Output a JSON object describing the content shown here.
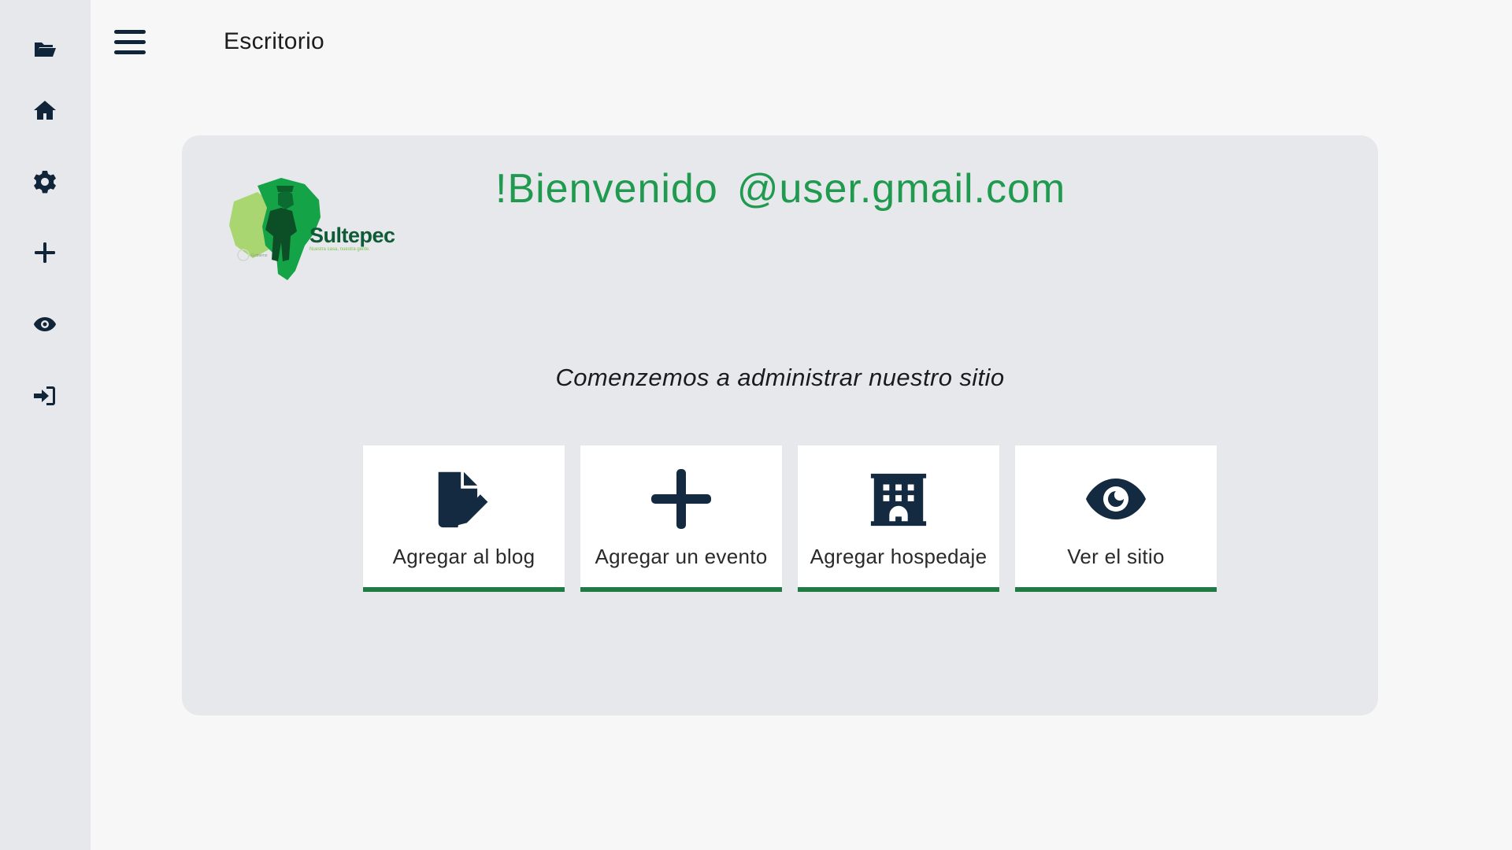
{
  "sidebar": {
    "items": [
      {
        "icon": "folder-open-icon"
      },
      {
        "icon": "home-icon"
      },
      {
        "icon": "gear-icon"
      },
      {
        "icon": "plus-icon"
      },
      {
        "icon": "eye-icon"
      },
      {
        "icon": "sign-in-icon"
      }
    ]
  },
  "header": {
    "menu_icon": "hamburger-icon",
    "title": "Escritorio"
  },
  "card": {
    "logo_text": "Sultepec",
    "logo_tagline": "Nuestra casa, nuestra gente.",
    "welcome_prefix": "!Bienvenido",
    "welcome_user": "@user.gmail.com",
    "subtitle": "Comenzemos a administrar nuestro sitio",
    "actions": [
      {
        "label": "Agregar al blog",
        "icon": "file-edit-icon"
      },
      {
        "label": "Agregar un evento",
        "icon": "plus-icon"
      },
      {
        "label": "Agregar hospedaje",
        "icon": "hotel-building-icon"
      },
      {
        "label": "Ver el sitio",
        "icon": "eye-icon"
      }
    ]
  },
  "colors": {
    "accent_green": "#1f9a4f",
    "tile_border": "#1f7a44",
    "icon_dark": "#10243a",
    "sidebar_bg": "#e7e8eb",
    "card_bg": "#e7e8ec"
  }
}
